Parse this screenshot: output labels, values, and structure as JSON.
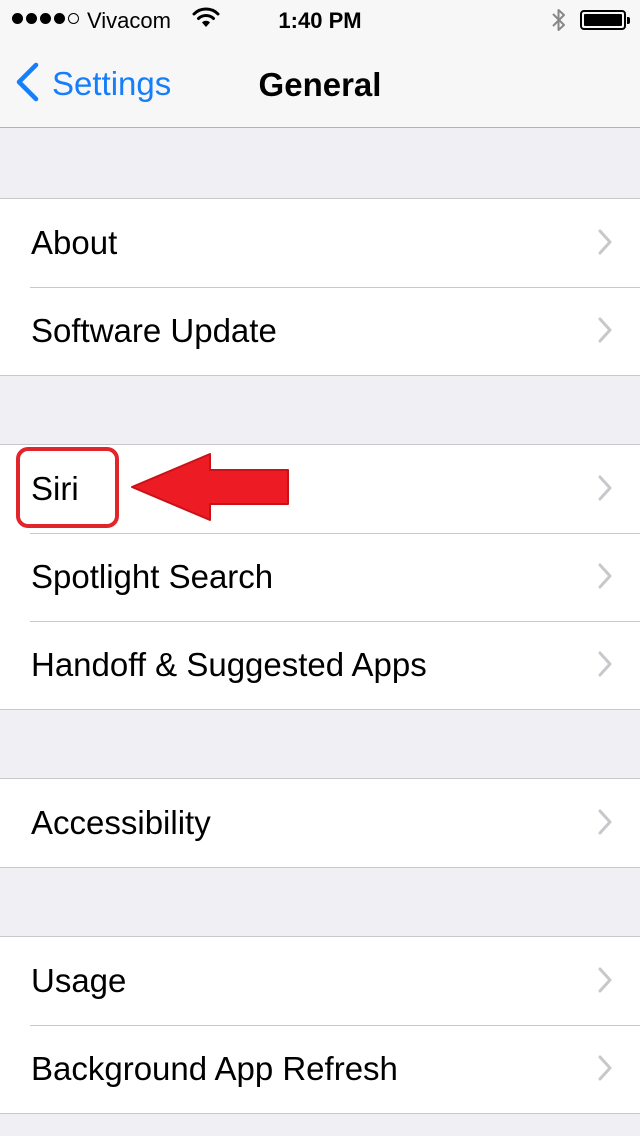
{
  "status_bar": {
    "carrier": "Vivacom",
    "time": "1:40 PM",
    "signal_bars_filled": 4,
    "signal_bars_total": 5,
    "battery_level": 1.0
  },
  "nav": {
    "back_label": "Settings",
    "title": "General"
  },
  "groups": [
    {
      "items": [
        {
          "label": "About"
        },
        {
          "label": "Software Update"
        }
      ]
    },
    {
      "items": [
        {
          "label": "Siri"
        },
        {
          "label": "Spotlight Search"
        },
        {
          "label": "Handoff & Suggested Apps"
        }
      ]
    },
    {
      "items": [
        {
          "label": "Accessibility"
        }
      ]
    },
    {
      "items": [
        {
          "label": "Usage"
        },
        {
          "label": "Background App Refresh"
        }
      ]
    }
  ],
  "annotation": {
    "color": "#e0252b"
  },
  "colors": {
    "accent": "#157efb",
    "background": "#efeff4",
    "chevron": "#c7c7cc"
  }
}
